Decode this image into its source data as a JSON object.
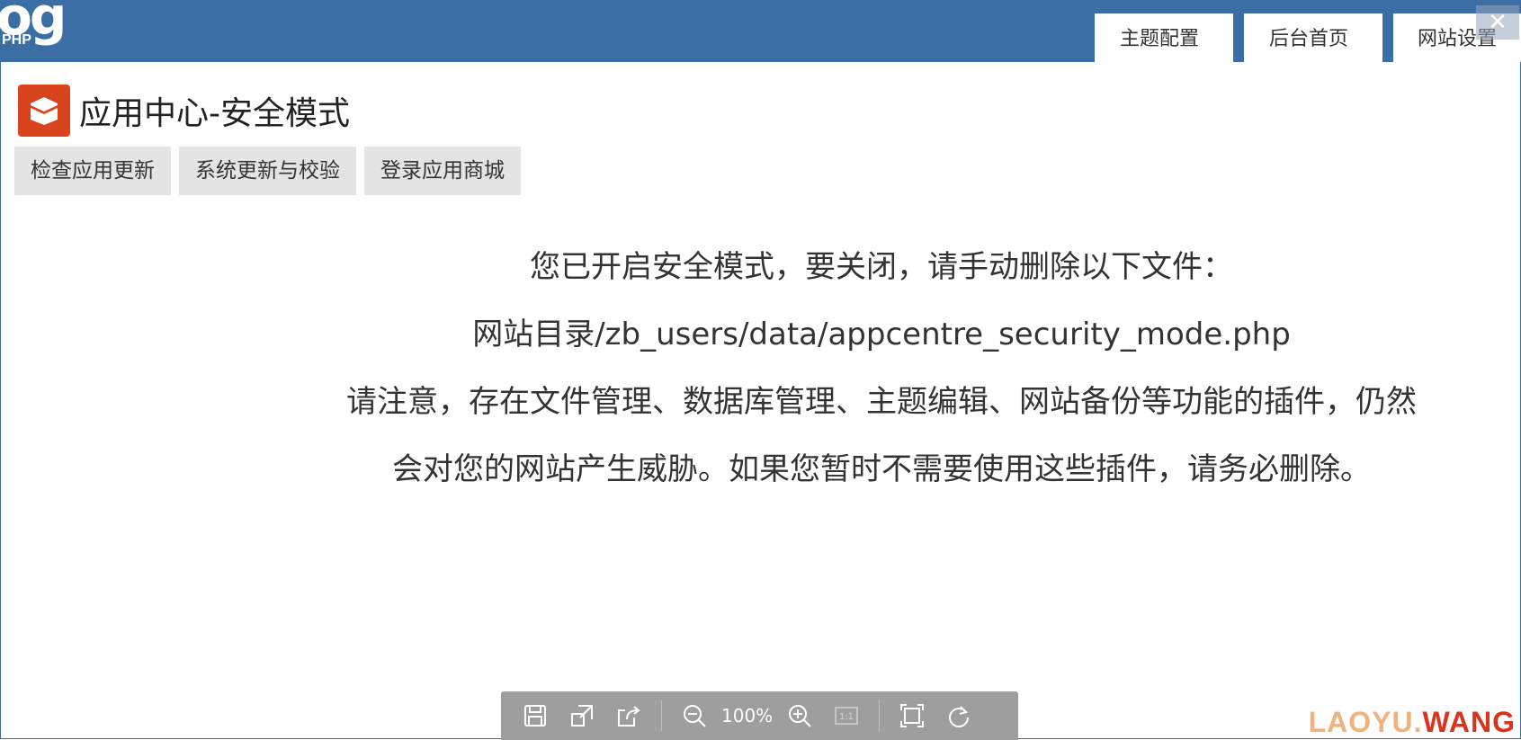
{
  "header": {
    "logo_main": "og",
    "logo_sub": "PHP",
    "tabs": [
      {
        "label": "主题配置"
      },
      {
        "label": "后台首页"
      },
      {
        "label": "网站设置"
      }
    ],
    "close_label": "✕"
  },
  "page": {
    "title": "应用中心-安全模式"
  },
  "actions": [
    {
      "label": "检查应用更新"
    },
    {
      "label": "系统更新与校验"
    },
    {
      "label": "登录应用商城"
    }
  ],
  "message": {
    "line1": "您已开启安全模式，要关闭，请手动删除以下文件：",
    "line2": "网站目录/zb_users/data/appcentre_security_mode.php",
    "warning": "请注意，存在文件管理、数据库管理、主题编辑、网站备份等功能的插件，仍然会对您的网站产生威胁。如果您暂时不需要使用这些插件，请务必删除。"
  },
  "toolbar": {
    "zoom": "100%",
    "actual_size": "1:1"
  },
  "watermark": {
    "part_a": "LAOYU.",
    "part_b": "WANG"
  },
  "colors": {
    "header": "#3b6ea5",
    "app_icon": "#d9431d",
    "toolbar": "#9e9e9e"
  }
}
